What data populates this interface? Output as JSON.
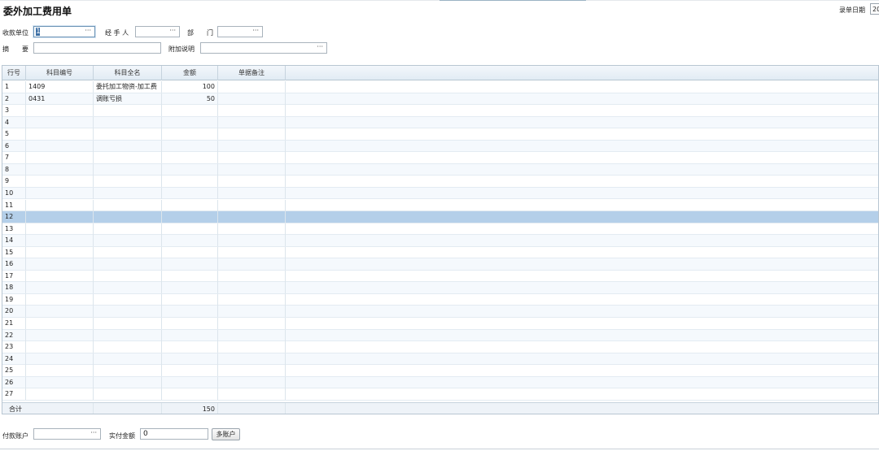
{
  "header": {
    "title": "委外加工费用单",
    "date_label": "录单日期",
    "date_value": "20"
  },
  "form": {
    "payee_label": "收款单位",
    "payee_value": "1",
    "handler_label": "经 手 人",
    "handler_value": "",
    "dept_label1": "部",
    "dept_label2": "门",
    "dept_value": "",
    "summary_label1": "摘",
    "summary_label2": "要",
    "summary_value": "",
    "extra_label": "附加说明",
    "extra_value": "",
    "dots": "···"
  },
  "grid": {
    "columns": [
      "行号",
      "科目编号",
      "科目全名",
      "金额",
      "单据备注"
    ],
    "rows": [
      {
        "no": "1",
        "code": "1409",
        "name": "委托加工物资-加工费",
        "amount": "100",
        "note": ""
      },
      {
        "no": "2",
        "code": "0431",
        "name": "调账亏损",
        "amount": "50",
        "note": ""
      },
      {
        "no": "3",
        "code": "",
        "name": "",
        "amount": "",
        "note": ""
      },
      {
        "no": "4",
        "code": "",
        "name": "",
        "amount": "",
        "note": ""
      },
      {
        "no": "5",
        "code": "",
        "name": "",
        "amount": "",
        "note": ""
      },
      {
        "no": "6",
        "code": "",
        "name": "",
        "amount": "",
        "note": ""
      },
      {
        "no": "7",
        "code": "",
        "name": "",
        "amount": "",
        "note": ""
      },
      {
        "no": "8",
        "code": "",
        "name": "",
        "amount": "",
        "note": ""
      },
      {
        "no": "9",
        "code": "",
        "name": "",
        "amount": "",
        "note": ""
      },
      {
        "no": "10",
        "code": "",
        "name": "",
        "amount": "",
        "note": ""
      },
      {
        "no": "11",
        "code": "",
        "name": "",
        "amount": "",
        "note": ""
      },
      {
        "no": "12",
        "code": "",
        "name": "",
        "amount": "",
        "note": ""
      },
      {
        "no": "13",
        "code": "",
        "name": "",
        "amount": "",
        "note": ""
      },
      {
        "no": "14",
        "code": "",
        "name": "",
        "amount": "",
        "note": ""
      },
      {
        "no": "15",
        "code": "",
        "name": "",
        "amount": "",
        "note": ""
      },
      {
        "no": "16",
        "code": "",
        "name": "",
        "amount": "",
        "note": ""
      },
      {
        "no": "17",
        "code": "",
        "name": "",
        "amount": "",
        "note": ""
      },
      {
        "no": "18",
        "code": "",
        "name": "",
        "amount": "",
        "note": ""
      },
      {
        "no": "19",
        "code": "",
        "name": "",
        "amount": "",
        "note": ""
      },
      {
        "no": "20",
        "code": "",
        "name": "",
        "amount": "",
        "note": ""
      },
      {
        "no": "21",
        "code": "",
        "name": "",
        "amount": "",
        "note": ""
      },
      {
        "no": "22",
        "code": "",
        "name": "",
        "amount": "",
        "note": ""
      },
      {
        "no": "23",
        "code": "",
        "name": "",
        "amount": "",
        "note": ""
      },
      {
        "no": "24",
        "code": "",
        "name": "",
        "amount": "",
        "note": ""
      },
      {
        "no": "25",
        "code": "",
        "name": "",
        "amount": "",
        "note": ""
      },
      {
        "no": "26",
        "code": "",
        "name": "",
        "amount": "",
        "note": ""
      },
      {
        "no": "27",
        "code": "",
        "name": "",
        "amount": "",
        "note": ""
      }
    ],
    "selected_row": "12",
    "total_label": "合计",
    "total_amount": "150"
  },
  "footer": {
    "account_label": "付款账户",
    "account_value": "",
    "paid_label": "实付金额",
    "paid_value": "0",
    "multi_account_button": "多账户"
  },
  "colors": {
    "selected_row": "#b4cfe9",
    "grid_border": "#b8c6d2",
    "header_bg": "#e1ebf4"
  }
}
